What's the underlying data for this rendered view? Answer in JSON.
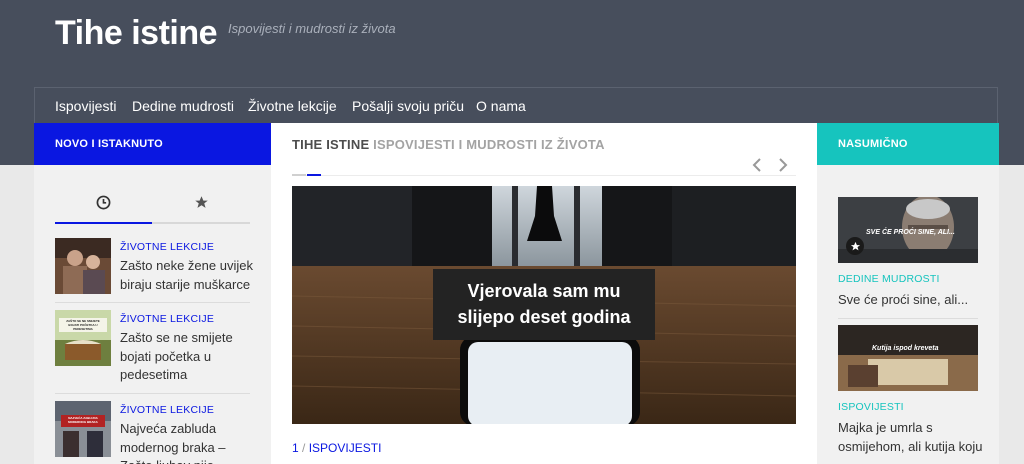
{
  "site": {
    "title": "Tihe istine",
    "tagline": "Ispovijesti i mudrosti iz života"
  },
  "nav": {
    "items": [
      "Ispovijesti",
      "Dedine mudrosti",
      "Životne lekcije",
      "Pošalji svoju priču",
      "O nama"
    ]
  },
  "left": {
    "heading": "NOVO I ISTAKNUTO",
    "tabs": [
      {
        "icon": "clock-icon",
        "active": true
      },
      {
        "icon": "star-icon",
        "active": false
      }
    ],
    "posts": [
      {
        "category": "ŽIVOTNE LEKCIJE",
        "title": "Zašto neke žene uvijek biraju starije muškarce"
      },
      {
        "category": "ŽIVOTNE LEKCIJE",
        "title": "Zašto se ne smijete bojati početka u pedesetima",
        "thumb_text": "ZAŠTO SE NE SMIJETE BOJATI POČETKA U PEDESETIMA"
      },
      {
        "category": "ŽIVOTNE LEKCIJE",
        "title": "Najveća zabluda modernog braka – Zašto ljubav nije",
        "thumb_text": "NAJVEĆA ZABLUDA MODERNOG BRAKA"
      }
    ]
  },
  "main": {
    "heading_bold": "TIHE ISTINE",
    "heading_light": "ISPOVIJESTI I MUDROSTI IZ ŽIVOTA",
    "hero_text_line1": "Vjerovala sam mu",
    "hero_text_line2": "slijepo deset godina",
    "meta_number": "1",
    "meta_separator": "/",
    "meta_category": "ISPOVIJESTI"
  },
  "right": {
    "heading": "NASUMIČNO",
    "cards": [
      {
        "category": "DEDINE MUDROSTI",
        "title": "Sve će proći sine, ali...",
        "img_text": "SVE ĆE PROĆI SINE, ALI..."
      },
      {
        "category": "ISPOVIJESTI",
        "title": "Majka je umrla s osmijehom, ali kutija koju",
        "img_text": "Kutija ispod kreveta"
      }
    ]
  },
  "colors": {
    "header": "#474e5c",
    "accent_blue": "#0a17e1",
    "accent_teal": "#16c4be"
  }
}
